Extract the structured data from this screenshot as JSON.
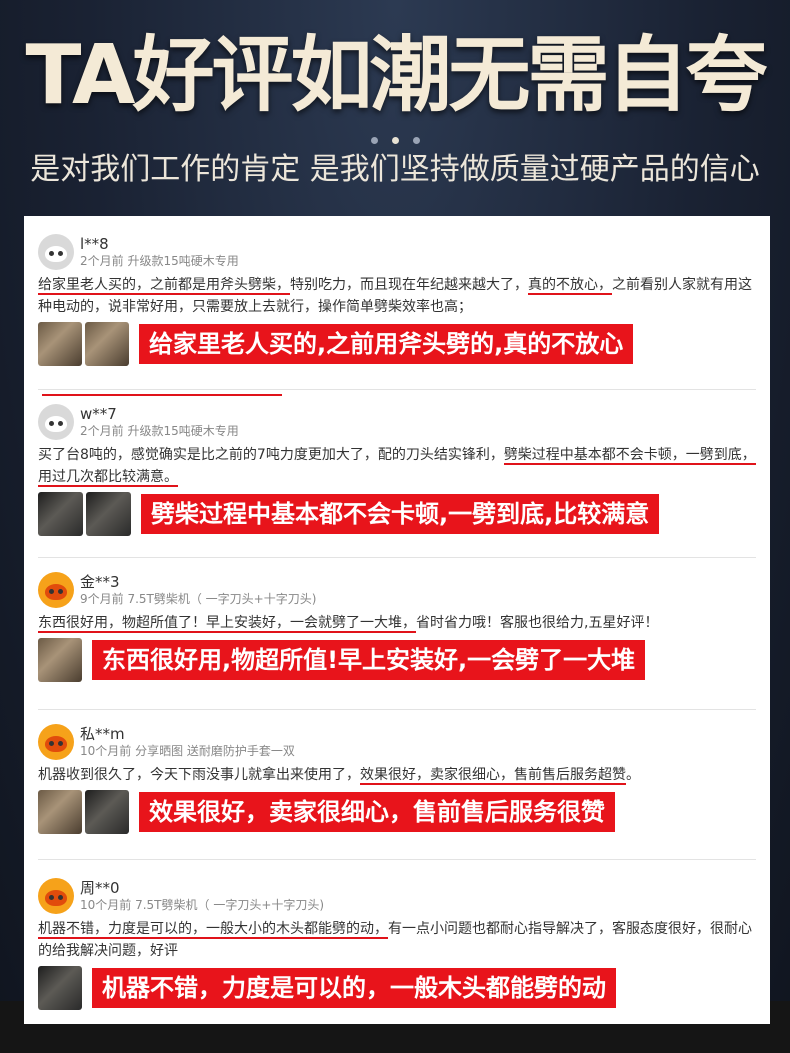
{
  "header": {
    "headline": "TA好评如潮无需自夸",
    "subhead": "是对我们工作的肯定 是我们坚持做质量过硬产品的信心"
  },
  "reviews": [
    {
      "name": "l**8",
      "meta": "2个月前 升级款15吨硬木专用",
      "text_parts": [
        {
          "t": "给家里老人买的，之前都是用斧头劈柴，",
          "u": true
        },
        {
          "t": "特别吃力，而且现在年纪越来越大了，",
          "u": false
        },
        {
          "t": "真的不放心，",
          "u": true
        },
        {
          "t": "之前看别人家就有用这种电动的，说非常好用，只需要放上去就行，操作简单劈柴效率也高；",
          "u": false
        }
      ],
      "banner": "给家里老人买的,之前用斧头劈的,真的不放心",
      "avatar": "gray",
      "thumbs": 2
    },
    {
      "name": "w**7",
      "meta": "2个月前 升级款15吨硬木专用",
      "text_parts": [
        {
          "t": "买了台8吨的，感觉确实是比之前的7吨力度更加大了，配的刀头结实锋利，",
          "u": false
        },
        {
          "t": "劈柴过程中基本都不会卡顿，一劈到底，用过几次都比较满意。",
          "u": true
        }
      ],
      "banner": "劈柴过程中基本都不会卡顿,一劈到底,比较满意",
      "avatar": "gray",
      "thumbs": 2
    },
    {
      "name": "金**3",
      "meta": "9个月前 7.5T劈柴机（ 一字刀头+十字刀头)",
      "text_parts": [
        {
          "t": "东西很好用，物超所值了！早上安装好，一会就劈了一大堆，",
          "u": true
        },
        {
          "t": "省时省力哦！客服也很给力,五星好评！",
          "u": false
        }
      ],
      "banner": "东西很好用,物超所值!早上安装好,一会劈了一大堆",
      "avatar": "orange",
      "thumbs": 1
    },
    {
      "name": "私**m",
      "meta": "10个月前 分享晒图 送耐磨防护手套一双",
      "text_parts": [
        {
          "t": "机器收到很久了，今天下雨没事儿就拿出来使用了，",
          "u": false
        },
        {
          "t": "效果很好，卖家很细心，售前售后服务超赞",
          "u": true
        },
        {
          "t": "。",
          "u": false
        }
      ],
      "banner": "效果很好，卖家很细心，售前售后服务很赞",
      "avatar": "orange",
      "thumbs": 2
    },
    {
      "name": "周**0",
      "meta": "10个月前 7.5T劈柴机（ 一字刀头+十字刀头)",
      "text_parts": [
        {
          "t": "机器不错，力度是可以的，一般大小的木头都能劈的动，",
          "u": true
        },
        {
          "t": "有一点小问题也都耐心指导解决了，客服态度很好，很耐心的给我解决问题，好评",
          "u": false
        }
      ],
      "banner": "机器不错，力度是可以的，一般木头都能劈的动",
      "avatar": "orange",
      "thumbs": 1
    }
  ],
  "colors": {
    "accent_red": "#e8141b",
    "headline": "#f4ead6",
    "background": "#1a2233"
  }
}
